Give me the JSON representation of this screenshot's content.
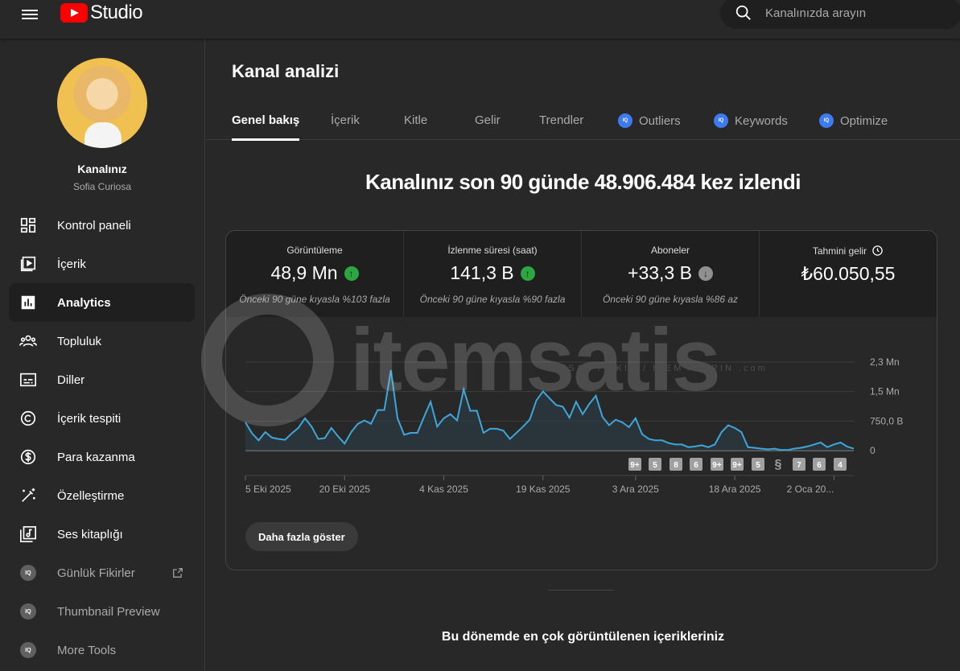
{
  "header": {
    "logo_text": "Studio",
    "search_placeholder": "Kanalınızda arayın"
  },
  "sidebar": {
    "channel_name": "Kanalınız",
    "channel_sub": "Sofia Curiosa",
    "items": [
      {
        "label": "Kontrol paneli",
        "icon": "dashboard-icon"
      },
      {
        "label": "İçerik",
        "icon": "content-icon"
      },
      {
        "label": "Analytics",
        "icon": "analytics-icon",
        "active": true
      },
      {
        "label": "Topluluk",
        "icon": "community-icon"
      },
      {
        "label": "Diller",
        "icon": "subtitles-icon"
      },
      {
        "label": "İçerik tespiti",
        "icon": "copyright-icon"
      },
      {
        "label": "Para kazanma",
        "icon": "dollar-icon"
      },
      {
        "label": "Özelleştirme",
        "icon": "magic-wand-icon"
      },
      {
        "label": "Ses kitaplığı",
        "icon": "audio-library-icon"
      }
    ],
    "tools": [
      {
        "label": "Günlük Fikirler",
        "external": true
      },
      {
        "label": "Thumbnail Preview"
      },
      {
        "label": "More Tools"
      }
    ],
    "tool_badge": "IQ"
  },
  "main": {
    "title": "Kanal analizi",
    "tabs": [
      {
        "label": "Genel bakış"
      },
      {
        "label": "İçerik"
      },
      {
        "label": "Kitle"
      },
      {
        "label": "Gelir"
      },
      {
        "label": "Trendler"
      },
      {
        "label": "Outliers",
        "iq": true
      },
      {
        "label": "Keywords",
        "iq": true
      },
      {
        "label": "Optimize",
        "iq": true
      }
    ],
    "headline": "Kanalınız son 90 günde 48.906.484 kez izlendi",
    "stats": [
      {
        "label": "Görüntüleme",
        "value": "48,9 Mn",
        "trend": "up",
        "compare": "Önceki 90 güne kıyasla %103 fazla"
      },
      {
        "label": "İzlenme süresi (saat)",
        "value": "141,3 B",
        "trend": "up",
        "compare": "Önceki 90 güne kıyasla %90 fazla"
      },
      {
        "label": "Aboneler",
        "value": "+33,3 B",
        "trend": "down",
        "compare": "Önceki 90 güne kıyasla %86 az"
      },
      {
        "label": "Tahmini gelir",
        "value": "₺60.050,55",
        "clock": true
      }
    ],
    "more_button": "Daha fazla göster",
    "section_title": "Bu dönemde en çok görüntülenen içerikleriniz"
  },
  "watermark": {
    "text": "itemsatis",
    "sub": "HESAP / SKIN / ITEM / E-PIN .com"
  },
  "colors": {
    "line": "#3ea6d8",
    "up": "#2ba640",
    "down": "#909090"
  },
  "chart_data": {
    "type": "area",
    "ylim": [
      0,
      2250000
    ],
    "y_ticks": [
      {
        "value": 0,
        "label": "0"
      },
      {
        "value": 750000,
        "label": "750,0 B"
      },
      {
        "value": 1500000,
        "label": "1,5 Mn"
      },
      {
        "value": 2250000,
        "label": "2,3 Mn"
      }
    ],
    "x_ticks": [
      {
        "index": 0,
        "label": "5 Eki 2025"
      },
      {
        "index": 15,
        "label": "20 Eki 2025"
      },
      {
        "index": 30,
        "label": "4 Kas 2025"
      },
      {
        "index": 45,
        "label": "19 Kas 2025"
      },
      {
        "index": 59,
        "label": "3 Ara 2025"
      },
      {
        "index": 74,
        "label": "18 Ara 2025"
      },
      {
        "index": 89,
        "label": "2 Oca 20..."
      }
    ],
    "values": [
      715000,
      435000,
      260000,
      470000,
      330000,
      295000,
      275000,
      435000,
      575000,
      820000,
      610000,
      295000,
      315000,
      575000,
      365000,
      175000,
      470000,
      680000,
      765000,
      680000,
      1030000,
      1030000,
      2045000,
      820000,
      400000,
      450000,
      450000,
      855000,
      1240000,
      610000,
      820000,
      925000,
      765000,
      1555000,
      1010000,
      1015000,
      450000,
      555000,
      555000,
      505000,
      295000,
      455000,
      610000,
      785000,
      1275000,
      1505000,
      1325000,
      1155000,
      1115000,
      835000,
      1240000,
      925000,
      1185000,
      1395000,
      855000,
      645000,
      785000,
      715000,
      595000,
      820000,
      415000,
      295000,
      260000,
      260000,
      190000,
      155000,
      155000,
      85000,
      105000,
      135000,
      85000,
      155000,
      470000,
      645000,
      575000,
      470000,
      85000,
      70000,
      50000,
      30000,
      50000,
      15000,
      15000,
      50000,
      70000,
      105000,
      155000,
      205000,
      85000,
      155000,
      205000,
      100000,
      50000
    ],
    "upload_badges": [
      "9+",
      "5",
      "8",
      "6",
      "9+",
      "9+",
      "5",
      "shorts",
      "7",
      "6",
      "4"
    ]
  }
}
